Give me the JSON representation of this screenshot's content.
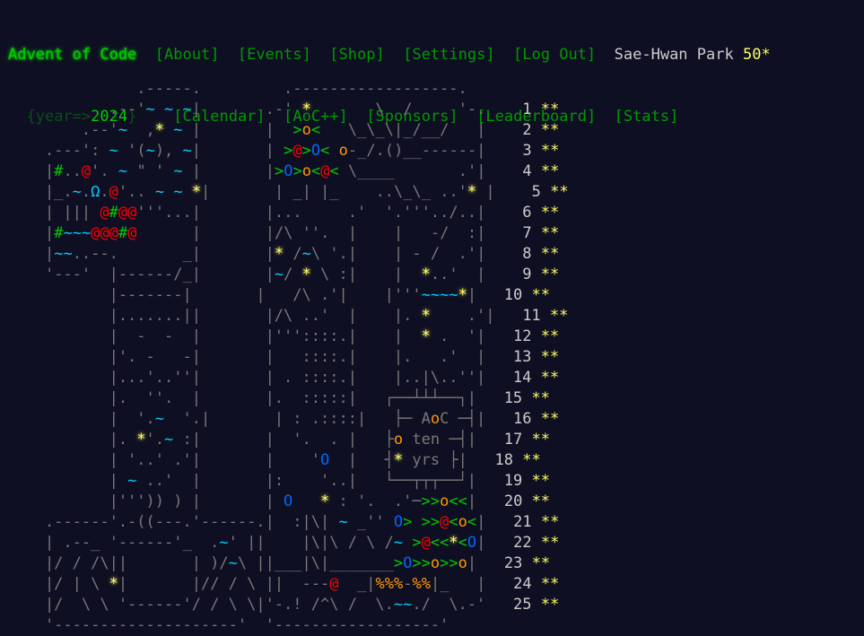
{
  "header": {
    "title": "Advent of Code",
    "nav_row1": [
      "[About]",
      "[Events]",
      "[Shop]",
      "[Settings]",
      "[Log Out]"
    ],
    "user": "Sae-Hwan Park",
    "star_count": "50*",
    "year_prefix": "{year=>",
    "year_value": "2024",
    "year_suffix": "}",
    "nav_row2": [
      "[Calendar]",
      "[AoC++]",
      "[Sponsors]",
      "[Leaderboard]",
      "[Stats]"
    ]
  },
  "calendar": {
    "days": [
      "1",
      "2",
      "3",
      "4",
      "5",
      "6",
      "7",
      "8",
      "9",
      "10",
      "11",
      "12",
      "13",
      "14",
      "15",
      "16",
      "17",
      "18",
      "19",
      "20",
      "21",
      "22",
      "23",
      "24",
      "25"
    ],
    "day_stars": "**",
    "art_lines": [
      "              .-----.         .------------------.      ",
      "           .--'~ ~ ~|       .-' *       \\  /     '-.   ",
      "        .--'~  ,* ~ |       |  >o<   \\_\\_\\|_/__/   |   ",
      "    .---': ~ '(~), ~|       | >@>O< o-_/.()__------|   ",
      "    |#..@'. ~ \" ' ~ |       |>O>o<@< \\____       .'|   ",
      "    |_.~.Ω.@'.. ~ ~ *|       | _| |_    ..\\_\\_ ..'* |   ",
      "    | ||| @#@@'''...|       |...     .'  '.'''../..|   ",
      "    |#~~~@@@#@      |       |/\\ ''.  |    |   -/  :|   ",
      "    |~~..--.       _|       |* /~\\ '.|    | - /  .'|   ",
      "    '---'  |------/_|       |~/ * \\ :|    |  *..'  |   ",
      "           |-------|       |   /\\ .'|    |'''~~~~*|   ",
      "           |.......||       |/\\ ..'  |    |. *    .'|   ",
      "           |  -  -  |       |'''::::.|    |  * .  '|   ",
      "           |'. -   -|       |   ::::.|    |.   .'  |   ",
      "           |...'..''|       | . ::::.|    |..|\\..''|   ",
      "           |.  ''.  |       |.  :::::|   ┌──┴┴┴──┐|   ",
      "           |  '.~  '.|       | : .::::|   ├─ AoC ─┤|   ",
      "           |. *'.~ :|       |  '.  . |   ├o ten ─┤|   ",
      "           | '..' .'|       |    'O  |   ┤* yrs ├|   ",
      "           | ~ ..'  |       |:    '..|   └──┬┬┬──┘|   ",
      "           |''')) ) |       | O   * : '.  .'─>>o<<|   ",
      "    .------'.-((---.'------.|  :|\\| ~ _'' O> >>@<o<|   ",
      "    | .--_ '------'_  .~' ||    |\\|\\ / \\ /~ >@<<*<O|   ",
      "    |/ / /\\||       | )/~\\ ||___|\\|_______>O>>o>>o|   ",
      "    |/ | \\ *|       |// / \\ ||  ---@  _|%%%-%%|_   |   ",
      "    |/  \\ \\ '------'/ / \\ \\|'-.! /^\\ /  \\.~~./  \\.-'   ",
      "    '--------------------'  '------------------'        "
    ]
  }
}
